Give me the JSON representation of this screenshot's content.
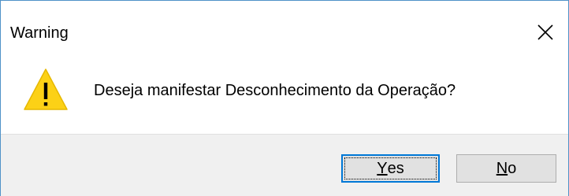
{
  "window": {
    "title": "Warning",
    "close_icon": "close-icon"
  },
  "content": {
    "icon": "warning-icon",
    "message": "Deseja manifestar Desconhecimento da Operação?"
  },
  "buttons": {
    "yes": {
      "mnemonic": "Y",
      "rest": "es",
      "default": true
    },
    "no": {
      "mnemonic": "N",
      "rest": "o"
    }
  },
  "colors": {
    "window_border": "#4f92c8",
    "footer_bg": "#f0f0f0",
    "button_bg": "#e1e1e1",
    "default_button_border": "#0078d7",
    "warning_fill": "#fcd116"
  }
}
